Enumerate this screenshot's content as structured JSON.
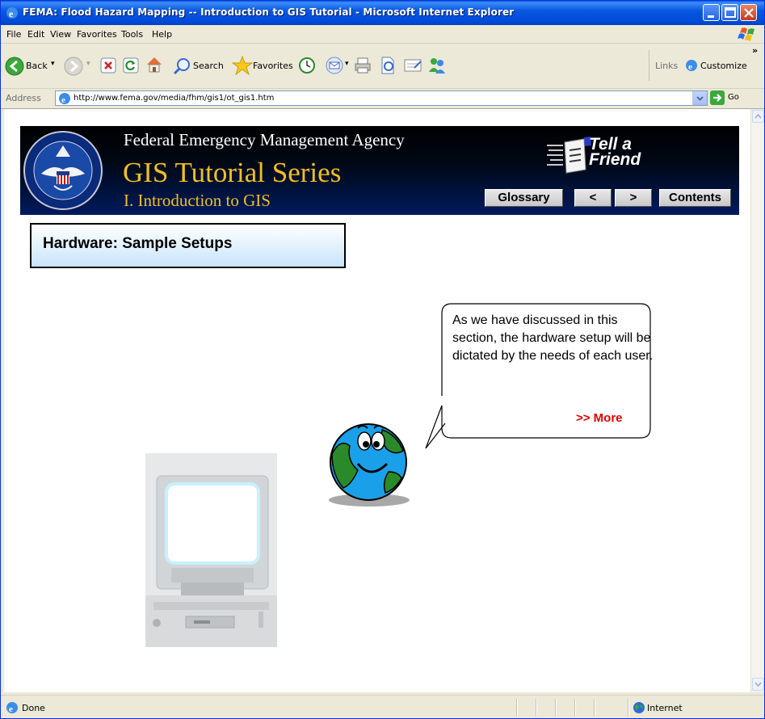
{
  "window": {
    "title": "FEMA: Flood Hazard Mapping -- Introduction to GIS Tutorial - Microsoft Internet Explorer"
  },
  "menu": {
    "items": [
      "File",
      "Edit",
      "View",
      "Favorites",
      "Tools",
      "Help"
    ]
  },
  "toolbar": {
    "back_label": "Back",
    "search_label": "Search",
    "favorites_label": "Favorites",
    "links_label": "Links",
    "customize_label": "Customize",
    "overflow_label": "»"
  },
  "address": {
    "label": "Address",
    "url": "http://www.fema.gov/media/fhm/gis1/ot_gis1.htm",
    "go_label": "Go"
  },
  "banner": {
    "agency": "Federal Emergency Management Agency",
    "series": "GIS Tutorial Series",
    "section": "I. Introduction to GIS",
    "tell_a_friend": "Tell a\nFriend",
    "nav": {
      "glossary": "Glossary",
      "prev": "<",
      "next": ">",
      "contents": "Contents"
    }
  },
  "page": {
    "heading": "Hardware: Sample Setups",
    "bubble_text": "As we have discussed in this section, the hardware setup will be dictated by the needs of each user.",
    "more_link": ">> More"
  },
  "status": {
    "text": "Done",
    "zone": "Internet"
  },
  "colors": {
    "banner_text": "#ffffff",
    "series_gold": "#f0c020",
    "more_red": "#e00000",
    "title_bar_blue": "#0858e0"
  }
}
